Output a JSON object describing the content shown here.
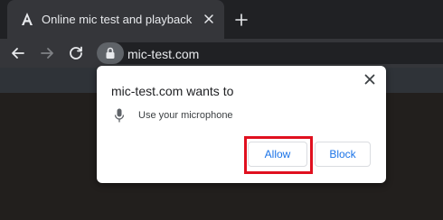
{
  "tab": {
    "title": "Online mic test and playback",
    "favicon": "stylized-A-logo"
  },
  "toolbar": {
    "url": "mic-test.com",
    "icons": [
      "back-arrow",
      "forward-arrow",
      "reload",
      "lock"
    ]
  },
  "permission_dialog": {
    "title": "mic-test.com wants to",
    "permission_label": "Use your microphone",
    "allow_label": "Allow",
    "block_label": "Block",
    "highlighted_button": "Allow"
  },
  "colors": {
    "tab_strip": "#202124",
    "toolbar": "#35363a",
    "dialog_button_text": "#1a73e8",
    "highlight_border": "#e0101f"
  }
}
